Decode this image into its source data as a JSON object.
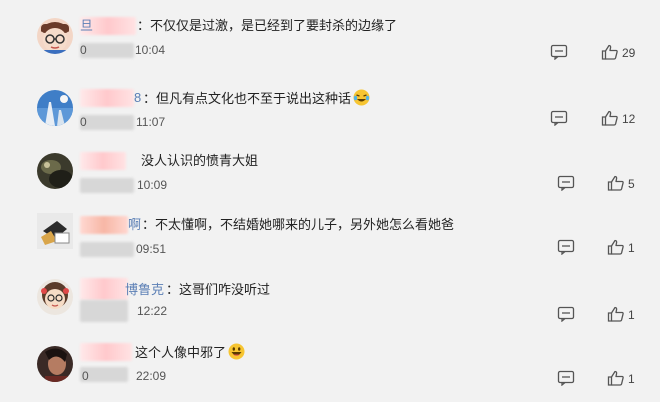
{
  "comments": [
    {
      "name_fragment": "旦",
      "text": "：不仅仅是过激，是已经到了要封杀的边缘了",
      "date_prefix": "0",
      "time": "10:04",
      "likes": "29",
      "avatar": "cartoon-glasses-boy-avatar"
    },
    {
      "name_fragment": "8",
      "text": "：但凡有点文化也不至于说出这种话",
      "emoji": "laughing-tears-emoji",
      "date_prefix": "0",
      "time": "11:07",
      "likes": "12",
      "avatar": "sky-landscape-avatar"
    },
    {
      "name_fragment": "",
      "text": "没人认识的愤青大姐",
      "date_prefix": "",
      "time": "10:09",
      "likes": "5",
      "avatar": "dark-photo-avatar"
    },
    {
      "name_fragment": "啊",
      "text": "：不太懂啊，不结婚她哪来的儿子，另外她怎么看她爸",
      "date_prefix": "",
      "time": "09:51",
      "likes": "1",
      "avatar": "cartoon-character-avatar"
    },
    {
      "name_fragment": "博鲁克",
      "text": "：这哥们咋没听过",
      "date_prefix": "",
      "time": "12:22",
      "likes": "1",
      "avatar": "cartoon-girl-avatar"
    },
    {
      "name_fragment": "",
      "text": "这个人像中邪了",
      "emoji": "grinning-emoji",
      "date_prefix": "0",
      "time": "22:09",
      "likes": "1",
      "avatar": "portrait-photo-avatar"
    }
  ],
  "colors": {
    "background": "#f2f2f2",
    "name": "#5b7fb5",
    "text": "#222222",
    "icon": "#555555"
  },
  "icons": {
    "reply": "comment-icon",
    "like": "thumbs-up-icon"
  }
}
